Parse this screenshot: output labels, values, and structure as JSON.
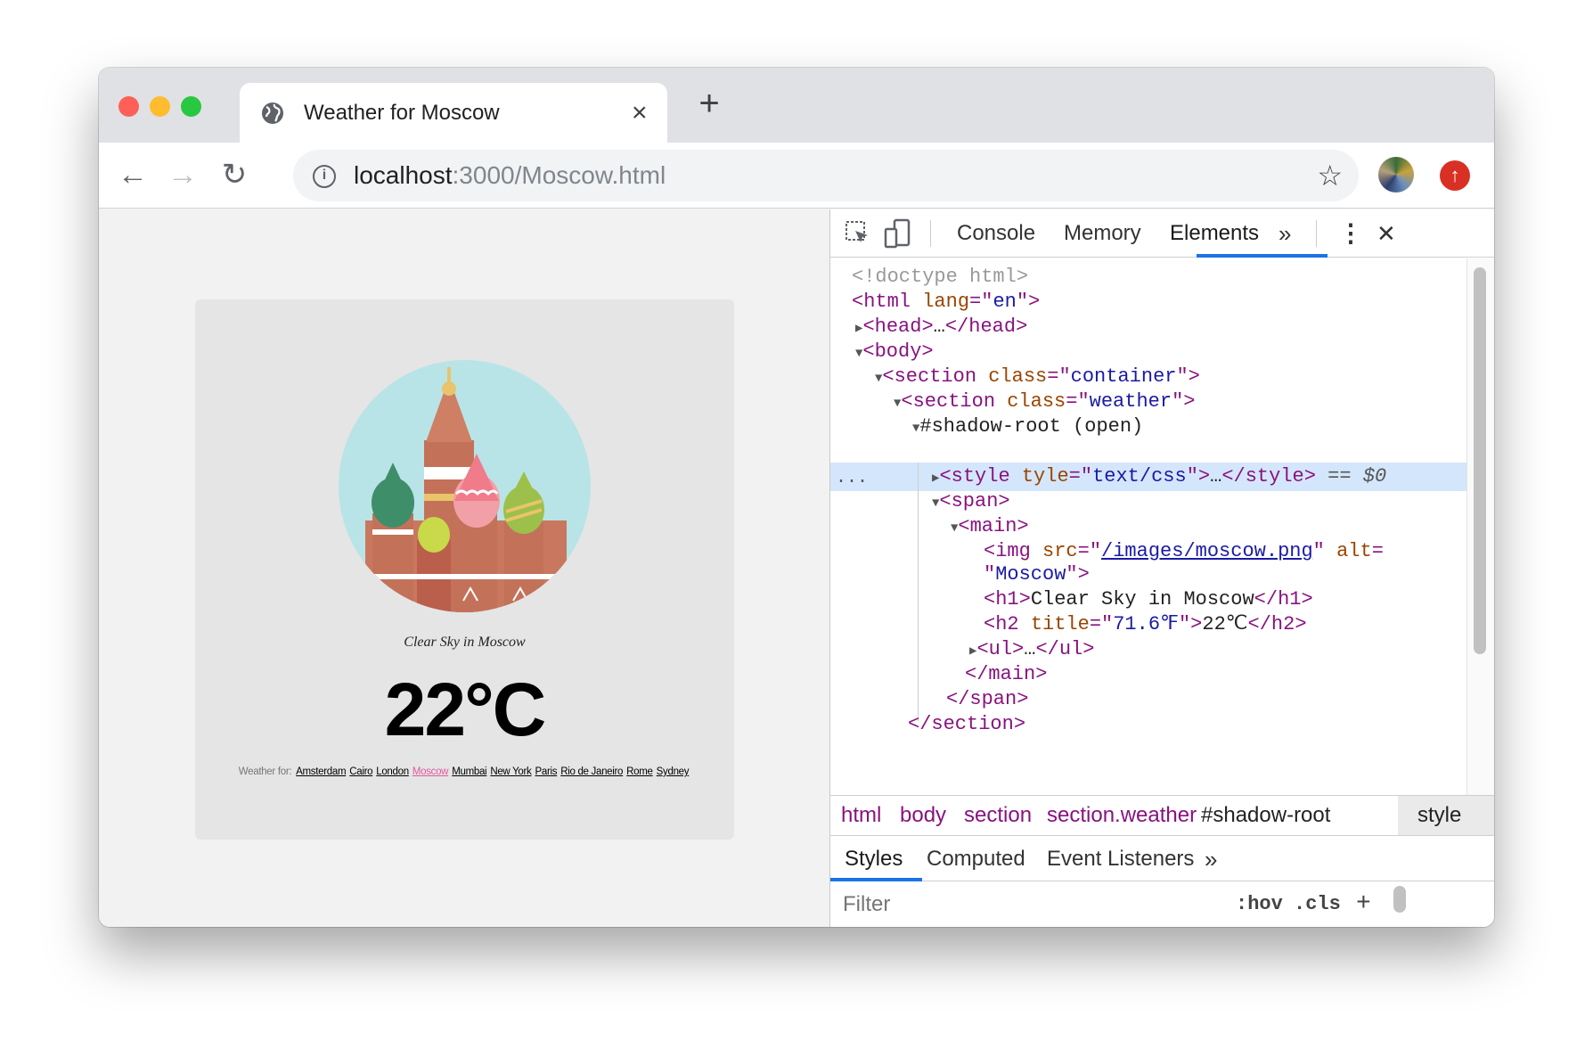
{
  "browser": {
    "tab_title": "Weather for Moscow",
    "tab_close": "×",
    "new_tab": "+",
    "back": "←",
    "forward": "→",
    "reload": "↻",
    "url_host": "localhost",
    "url_path": ":3000/Moscow.html",
    "bookmark_star": "☆",
    "update_icon": "↑"
  },
  "page": {
    "heading": "Clear Sky in Moscow",
    "temperature": "22°C",
    "weather_for_label": "Weather for:",
    "cities": [
      "Amsterdam",
      "Cairo",
      "London",
      "Moscow",
      "Mumbai",
      "New York",
      "Paris",
      "Rio de Janeiro",
      "Rome",
      "Sydney"
    ],
    "active_city": "Moscow",
    "image_alt": "Moscow"
  },
  "devtools": {
    "tabs": [
      "Console",
      "Memory",
      "Elements"
    ],
    "selected_tab": "Elements",
    "more": "»",
    "kebab": "⋮",
    "close": "✕",
    "tree": {
      "doctype": "<!doctype html>",
      "html_tag": "html",
      "lang_attr": "lang",
      "lang_val": "en",
      "head_tag": "head",
      "body_tag": "body",
      "section_tag": "section",
      "class_attr": "class",
      "container_val": "container",
      "weather_val": "weather",
      "shadow_root": "#shadow-root (open)",
      "style_tag": "style",
      "type_attr": "tyle",
      "type_val": "text/css",
      "selected_marker": "== $0",
      "span_tag": "span",
      "main_tag": "main",
      "img_tag": "img",
      "src_attr": "src",
      "src_val": "/images/moscow.png",
      "alt_attr": "alt",
      "alt_val": "Moscow",
      "h1_tag": "h1",
      "h1_text": "Clear Sky in Moscow",
      "h2_tag": "h2",
      "title_attr": "title",
      "title_val": "71.6℉",
      "h2_text": "22℃",
      "ul_tag": "ul",
      "ellipsis": "…",
      "dots": "..."
    },
    "breadcrumbs": [
      "html",
      "body",
      "section",
      "section.weather",
      "#shadow-root",
      "style"
    ],
    "subtabs": [
      "Styles",
      "Computed",
      "Event Listeners"
    ],
    "filter_placeholder": "Filter",
    "hov": ":hov",
    "cls": ".cls",
    "add": "+"
  }
}
